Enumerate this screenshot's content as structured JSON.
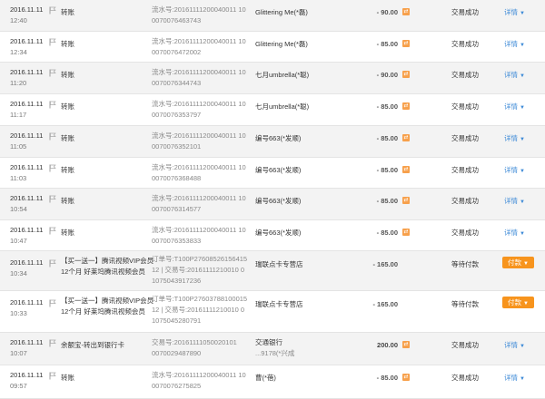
{
  "transactions": [
    {
      "date": "2016.11.11",
      "time": "12:40",
      "name": "转账",
      "serial_l1": "流水号:20161111200040011 10",
      "serial_l2": "0070076463743",
      "party": "Glittering Me(*磊)",
      "party2": "",
      "amount": "- 90.00",
      "status": "交易成功",
      "action": "详情",
      "action_type": "detail"
    },
    {
      "date": "2016.11.11",
      "time": "12:34",
      "name": "转账",
      "serial_l1": "流水号:20161111200040011 10",
      "serial_l2": "0070076472002",
      "party": "Glittering Me(*磊)",
      "party2": "",
      "amount": "- 85.00",
      "status": "交易成功",
      "action": "详情",
      "action_type": "detail"
    },
    {
      "date": "2016.11.11",
      "time": "11:20",
      "name": "转账",
      "serial_l1": "流水号:20161111200040011 10",
      "serial_l2": "0070076344743",
      "party": "七月umbrella(*聪)",
      "party2": "",
      "amount": "- 90.00",
      "status": "交易成功",
      "action": "详情",
      "action_type": "detail"
    },
    {
      "date": "2016.11.11",
      "time": "11:17",
      "name": "转账",
      "serial_l1": "流水号:20161111200040011 10",
      "serial_l2": "0070076353797",
      "party": "七月umbrella(*聪)",
      "party2": "",
      "amount": "- 85.00",
      "status": "交易成功",
      "action": "详情",
      "action_type": "detail"
    },
    {
      "date": "2016.11.11",
      "time": "11:05",
      "name": "转账",
      "serial_l1": "流水号:20161111200040011 10",
      "serial_l2": "0070076352101",
      "party": "编号663(*发顺)",
      "party2": "",
      "amount": "- 85.00",
      "status": "交易成功",
      "action": "详情",
      "action_type": "detail"
    },
    {
      "date": "2016.11.11",
      "time": "11:03",
      "name": "转账",
      "serial_l1": "流水号:20161111200040011 10",
      "serial_l2": "0070076368488",
      "party": "编号663(*发顺)",
      "party2": "",
      "amount": "- 85.00",
      "status": "交易成功",
      "action": "详情",
      "action_type": "detail"
    },
    {
      "date": "2016.11.11",
      "time": "10:54",
      "name": "转账",
      "serial_l1": "流水号:20161111200040011 10",
      "serial_l2": "0070076314577",
      "party": "编号663(*发顺)",
      "party2": "",
      "amount": "- 85.00",
      "status": "交易成功",
      "action": "详情",
      "action_type": "detail"
    },
    {
      "date": "2016.11.11",
      "time": "10:47",
      "name": "转账",
      "serial_l1": "流水号:20161111200040011 10",
      "serial_l2": "0070076353833",
      "party": "编号663(*发顺)",
      "party2": "",
      "amount": "- 85.00",
      "status": "交易成功",
      "action": "详情",
      "action_type": "detail"
    },
    {
      "date": "2016.11.11",
      "time": "10:34",
      "name": "【买一送一】腾讯视频VIP会员12个月 好莱坞腾讯视频会员",
      "serial_l1": "订单号:T100P27608526156415",
      "serial_l2": "12 | 交易号:20161111210010 0",
      "serial_l3": "1075043917236",
      "party": "瑞联点卡专营店",
      "party2": "",
      "amount": "- 165.00",
      "status": "等待付款",
      "action": "付款",
      "action_type": "pay"
    },
    {
      "date": "2016.11.11",
      "time": "10:33",
      "name": "【买一送一】腾讯视频VIP会员12个月 好莱坞腾讯视频会员",
      "serial_l1": "订单号:T100P27603788100015",
      "serial_l2": "12 | 交易号:20161111210010 0",
      "serial_l3": "1075045280791",
      "party": "瑞联点卡专营店",
      "party2": "",
      "amount": "- 165.00",
      "status": "等待付款",
      "action": "付款",
      "action_type": "pay"
    },
    {
      "date": "2016.11.11",
      "time": "10:07",
      "name": "余额宝-转出到银行卡",
      "serial_l1": "交易号:20161111050020101",
      "serial_l2": "0070029487890",
      "party": "交通银行",
      "party2": "...9178(*兴成",
      "amount": "200.00",
      "status": "交易成功",
      "action": "详情",
      "action_type": "detail"
    },
    {
      "date": "2016.11.11",
      "time": "09:57",
      "name": "转账",
      "serial_l1": "流水号:20161111200040011 10",
      "serial_l2": "0070076275825",
      "party": "曹(*蓓)",
      "party2": "",
      "amount": "- 85.00",
      "status": "交易成功",
      "action": "详情",
      "action_type": "detail"
    }
  ],
  "icons": {
    "flag": "flag-icon",
    "transfer": "transfer-icon",
    "caret": "caret-down-icon"
  },
  "colors": {
    "link": "#3d8ad7",
    "pay_button": "#f7941d",
    "transfer_icon": "#f7a04b",
    "shade": "#f3f3f3"
  }
}
